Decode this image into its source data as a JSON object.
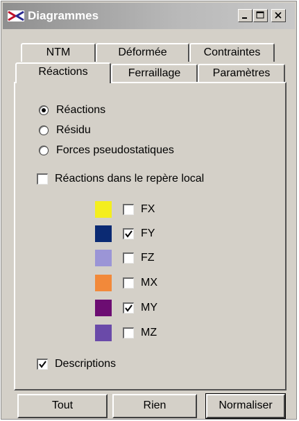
{
  "window": {
    "title": "Diagrammes"
  },
  "tabs_back": [
    "NTM",
    "Déformée",
    "Contraintes"
  ],
  "tabs_front": [
    "Réactions",
    "Ferraillage",
    "Paramètres"
  ],
  "active_tab": "Réactions",
  "radios": [
    {
      "label": "Réactions",
      "selected": true
    },
    {
      "label": "Résidu",
      "selected": false
    },
    {
      "label": "Forces pseudostatiques",
      "selected": false
    }
  ],
  "local_frame": {
    "label": "Réactions dans le repère local",
    "checked": false
  },
  "components": [
    {
      "label": "FX",
      "color": "#f4ee1e",
      "checked": false
    },
    {
      "label": "FY",
      "color": "#0b2a73",
      "checked": true
    },
    {
      "label": "FZ",
      "color": "#9b95d6",
      "checked": false
    },
    {
      "label": "MX",
      "color": "#f2893a",
      "checked": false
    },
    {
      "label": "MY",
      "color": "#6c0d72",
      "checked": true
    },
    {
      "label": "MZ",
      "color": "#6a4aa9",
      "checked": false
    }
  ],
  "descriptions": {
    "label": "Descriptions",
    "checked": true
  },
  "buttons": {
    "all": "Tout",
    "none": "Rien",
    "normalize": "Normaliser"
  }
}
